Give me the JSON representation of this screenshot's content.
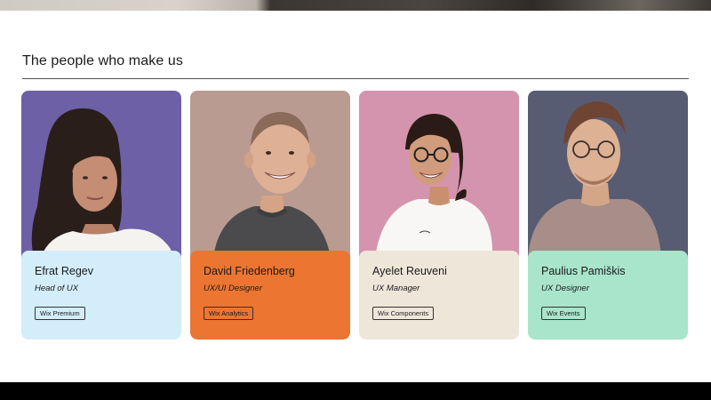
{
  "section": {
    "title": "The people who make us"
  },
  "people": [
    {
      "name": "Efrat Regev",
      "role": "Head of UX",
      "tag": "Wix Premium",
      "photo_bg": "#6d60a6",
      "info_bg": "#d3edfb"
    },
    {
      "name": "David Friedenberg",
      "role": "UX/UI Designer",
      "tag": "Wix Analytics",
      "photo_bg": "#ba9b92",
      "info_bg": "#ec7532"
    },
    {
      "name": "Ayelet Reuveni",
      "role": "UX Manager",
      "tag": "Wix Components",
      "photo_bg": "#d594ad",
      "info_bg": "#efe6da"
    },
    {
      "name": "Paulius Pamiškis",
      "role": "UX Designer",
      "tag": "Wix Events",
      "photo_bg": "#585c72",
      "info_bg": "#a8e5cb"
    }
  ]
}
